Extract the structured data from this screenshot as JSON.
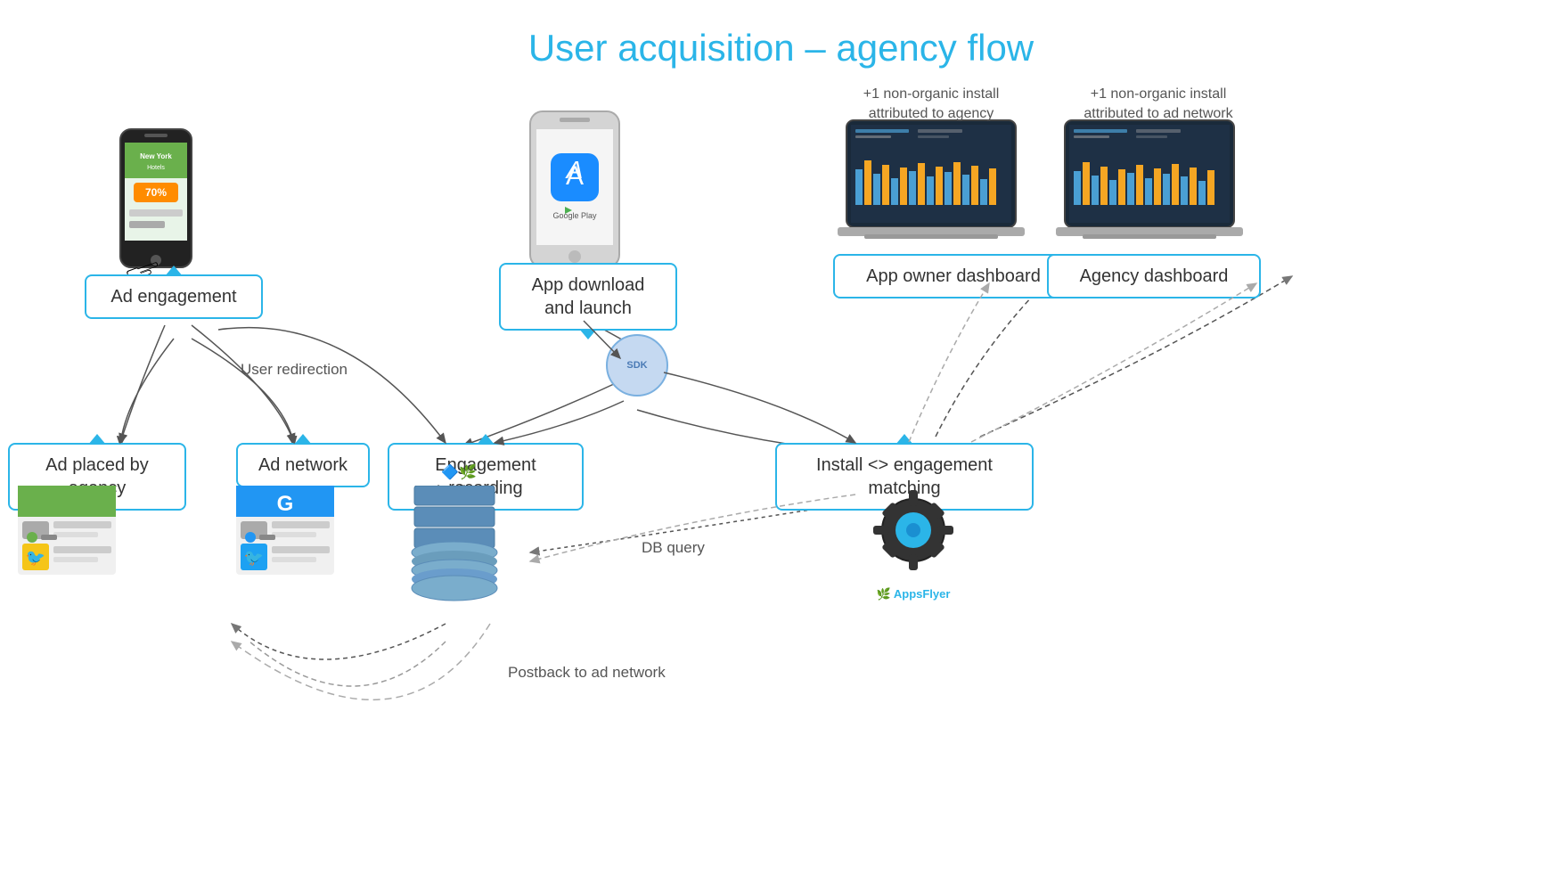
{
  "title": "User acquisition – agency flow",
  "callouts": {
    "ad_engagement": "Ad engagement",
    "app_download": "App download\nand launch",
    "ad_placed": "Ad placed by agency",
    "ad_network": "Ad network",
    "engagement_recording": "Engagement recording",
    "install_matching": "Install <> engagement matching",
    "app_owner_dashboard": "App owner dashboard",
    "agency_dashboard": "Agency dashboard"
  },
  "labels": {
    "user_redirection": "User redirection",
    "db_query": "DB query",
    "postback": "Postback to ad network"
  },
  "top_notes": {
    "app_owner": "+1 non-organic install\nattributed to agency",
    "agency": "+1 non-organic install\nattributed to ad network"
  },
  "sdk_label": "SDK",
  "appsflyer_label": "AppsFlyer"
}
